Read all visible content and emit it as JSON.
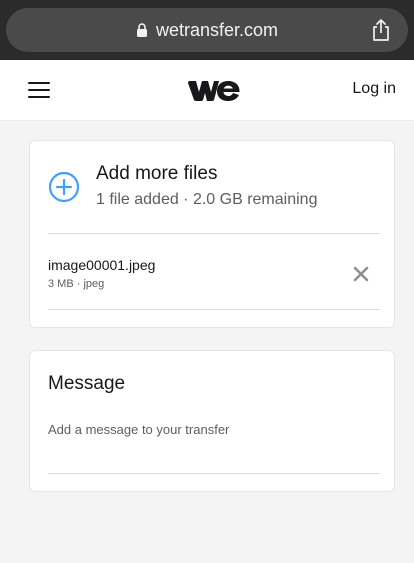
{
  "browser": {
    "url": "wetransfer.com",
    "icons": {
      "lock": "lock-icon",
      "share": "share-icon"
    },
    "colors": {
      "bar": "#2b2b2b",
      "pill": "#4a4a4a"
    }
  },
  "header": {
    "menu_icon": "hamburger-icon",
    "logo": "wetransfer-logo",
    "login_label": "Log in"
  },
  "upload": {
    "add_icon": "plus-circle-icon",
    "add_label": "Add more files",
    "status": "1 file added · 2.0 GB remaining",
    "files": [
      {
        "name": "image00001.jpeg",
        "meta": "3 MB · jpeg",
        "remove_icon": "close-icon"
      }
    ]
  },
  "message": {
    "title": "Message",
    "placeholder": "Add a message to your transfer",
    "value": ""
  },
  "colors": {
    "accent": "#409fff",
    "background": "#f4f4f4",
    "card": "#ffffff",
    "text": "#17181a",
    "muted": "#5c5e62"
  }
}
